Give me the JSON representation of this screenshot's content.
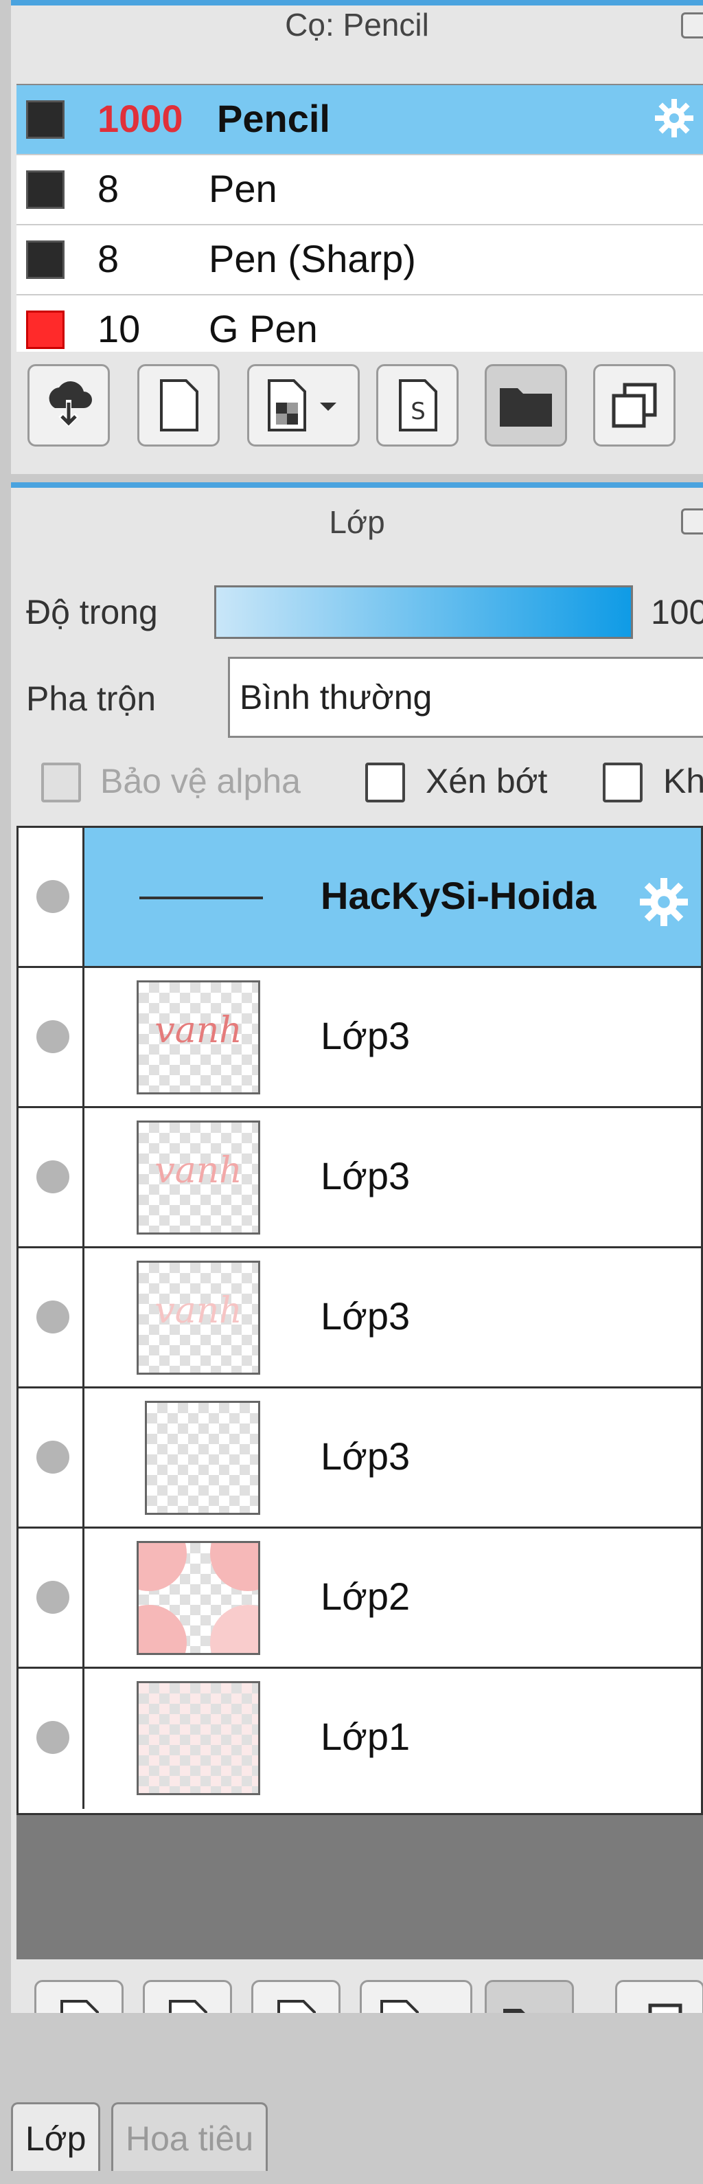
{
  "brush_panel": {
    "title": "Cọ: Pencil",
    "brushes": [
      {
        "size": "1000",
        "name": "Pencil",
        "color": "#2a2a2a",
        "selected": true
      },
      {
        "size": "8",
        "name": "Pen",
        "color": "#2a2a2a",
        "selected": false
      },
      {
        "size": "8",
        "name": "Pen (Sharp)",
        "color": "#2a2a2a",
        "selected": false
      },
      {
        "size": "10",
        "name": "G Pen",
        "color": "#ff2a2a",
        "selected": false
      }
    ],
    "toolbar_icons": [
      "download-icon",
      "new-brush-icon",
      "brush-type-dropdown-icon",
      "script-icon",
      "folder-icon",
      "duplicate-icon"
    ]
  },
  "layer_panel": {
    "title": "Lớp",
    "opacity_label": "Độ trong",
    "opacity_value": "100",
    "opacity_percent": 100,
    "blend_label": "Pha trộn",
    "blend_value": "Bình thường",
    "alpha_protect_label": "Bảo vệ alpha",
    "clip_label": "Xén bớt",
    "lock_label": "Kh",
    "layers": [
      {
        "name": "HacKySi-Hoida",
        "selected": true,
        "thumb": "line"
      },
      {
        "name": "Lớp3",
        "selected": false,
        "thumb_text": "vanh"
      },
      {
        "name": "Lớp3",
        "selected": false,
        "thumb_text": "vanh"
      },
      {
        "name": "Lớp3",
        "selected": false,
        "thumb_text": "vanh"
      },
      {
        "name": "Lớp3",
        "selected": false,
        "thumb_text": ""
      },
      {
        "name": "Lớp2",
        "selected": false,
        "thumb_text": ""
      },
      {
        "name": "Lớp1",
        "selected": false,
        "thumb_text": ""
      }
    ],
    "toolbar_icons": [
      "new-layer-icon",
      "new-layer-8bit-icon",
      "new-layer-1bit-icon",
      "add-layer-dropdown-icon",
      "new-folder-icon",
      "duplicate-layer-icon"
    ]
  },
  "tabs": [
    {
      "label": "Lớp",
      "active": true
    },
    {
      "label": "Hoa tiêu",
      "active": false
    }
  ],
  "colors": {
    "accent": "#4aa3df",
    "selection": "#79c8f2",
    "panel_bg": "#e6e6e6"
  }
}
